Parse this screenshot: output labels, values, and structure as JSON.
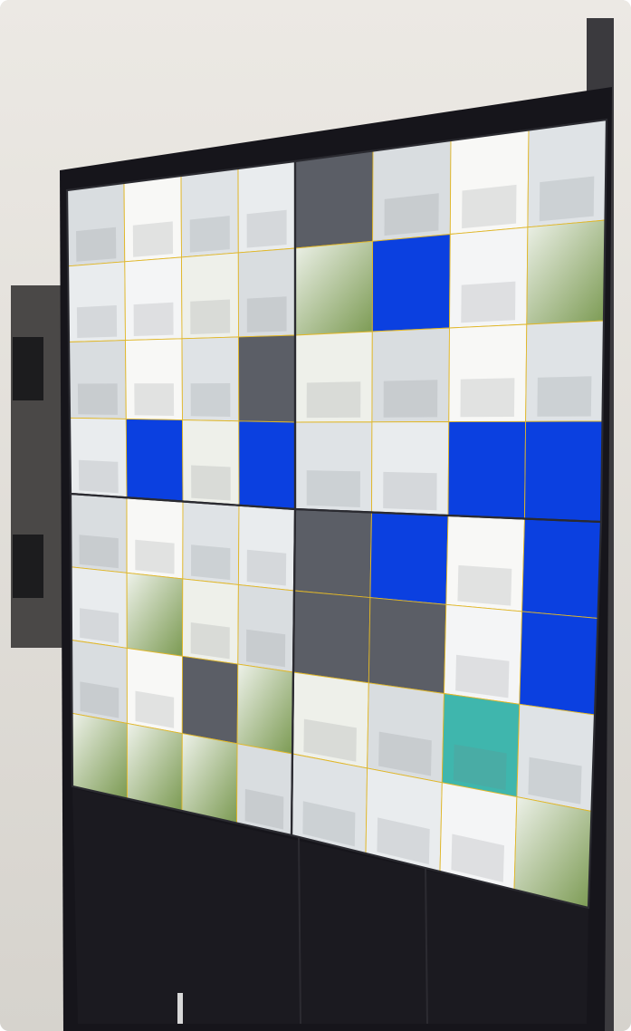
{
  "scene": {
    "subject": "cctv-video-wall",
    "colors": {
      "wall_upper": "#e9e7e2",
      "wall_lower": "#dcd9d3",
      "frame": "#16151b",
      "cabinet": "#1a191f",
      "blank_channel": "#0b40e0",
      "tile_divider": "#e0b72a",
      "monitor_seam": "#2a2a30"
    },
    "wall_grid": {
      "monitor_rows": 2,
      "monitor_cols": 2,
      "tile_rows_per_monitor": 4,
      "tile_cols_per_monitor": 4
    },
    "monitors": [
      {
        "id": "upper-left",
        "blank_tiles": [
          [
            3,
            1
          ],
          [
            3,
            3
          ]
        ]
      },
      {
        "id": "upper-right",
        "blank_tiles": [
          [
            1,
            1
          ],
          [
            3,
            3
          ]
        ],
        "merged_blank": [
          [
            3,
            2
          ],
          [
            3,
            3
          ]
        ]
      },
      {
        "id": "lower-left",
        "blank_tiles": []
      },
      {
        "id": "lower-right",
        "blank_tiles": [
          [
            0,
            1
          ]
        ],
        "merged_blank": [
          [
            0,
            3
          ],
          [
            1,
            3
          ]
        ]
      }
    ]
  }
}
